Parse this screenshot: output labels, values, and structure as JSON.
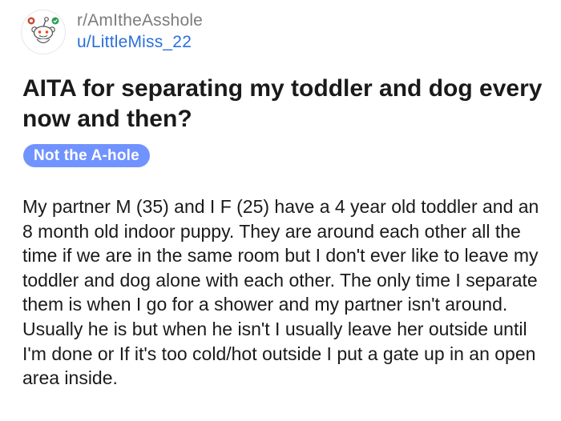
{
  "post": {
    "subreddit": "r/AmItheAsshole",
    "username": "u/LittleMiss_22",
    "avatar_icon": "snoo-avatar-icon",
    "title": "AITA for separating my toddler and dog every now and then?",
    "flair": "Not the A-hole",
    "body": "My partner M (35) and I F (25) have a 4 year old toddler and an 8 month old indoor puppy. They are around each other all the time if we are in the same room but I don't ever like to leave my toddler and dog alone with each other. The only time I separate them is when I go for a shower and my partner isn't around. Usually he is but when he isn't I usually leave her outside until I'm done or If it's too cold/hot outside I put a gate up in an open area inside."
  },
  "colors": {
    "username": "#2a6fdb",
    "subreddit": "#7c7c7c",
    "flair_background": "#7193ff",
    "flair_text": "#ffffff",
    "text": "#1a1a1b"
  }
}
